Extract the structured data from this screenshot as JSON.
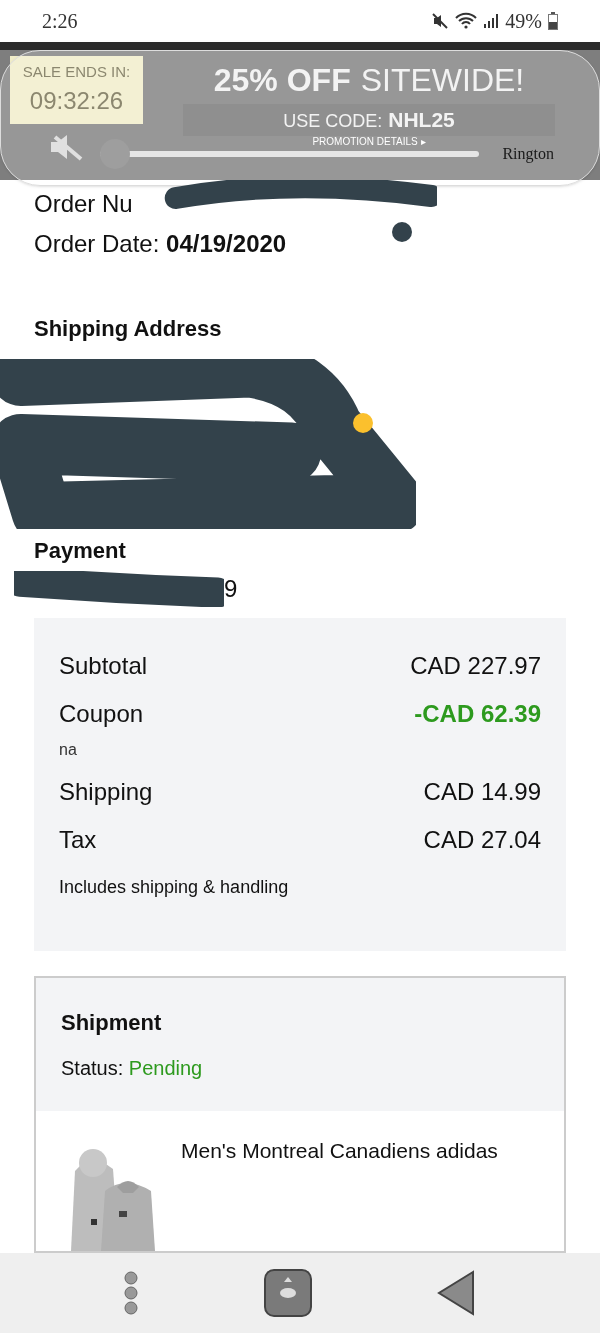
{
  "status_bar": {
    "time": "2:26",
    "battery": "49%"
  },
  "promo_banner": {
    "sale_label": "SALE ENDS IN:",
    "countdown": "09:32:26",
    "headline_bold": "25% OFF",
    "headline_light": "SITEWIDE!",
    "code_label": "USE CODE:",
    "code": "NHL25",
    "details_link": "PROMOTION DETAILS ▸"
  },
  "volume_panel": {
    "label": "Rington",
    "muted": true,
    "level": 0
  },
  "order": {
    "number_label": "Order Nu",
    "date_label": "Order Date:",
    "date": "04/19/2020"
  },
  "shipping_address": {
    "heading": "Shipping Address"
  },
  "payment": {
    "heading": "Payment",
    "visible_text": "9"
  },
  "summary": {
    "rows": [
      {
        "label": "Subtotal",
        "value": "CAD 227.97",
        "kind": "normal"
      },
      {
        "label": "Coupon",
        "value": "-CAD 62.39",
        "kind": "discount",
        "note": "na"
      },
      {
        "label": "Shipping",
        "value": "CAD 14.99",
        "kind": "normal"
      },
      {
        "label": "Tax",
        "value": "CAD 27.04",
        "kind": "normal"
      }
    ],
    "footnote": "Includes shipping & handling"
  },
  "shipment": {
    "heading": "Shipment",
    "status_label": "Status:",
    "status": "Pending",
    "items": [
      {
        "title": "Men's Montreal Canadiens adidas",
        "kind": "picture"
      }
    ]
  }
}
